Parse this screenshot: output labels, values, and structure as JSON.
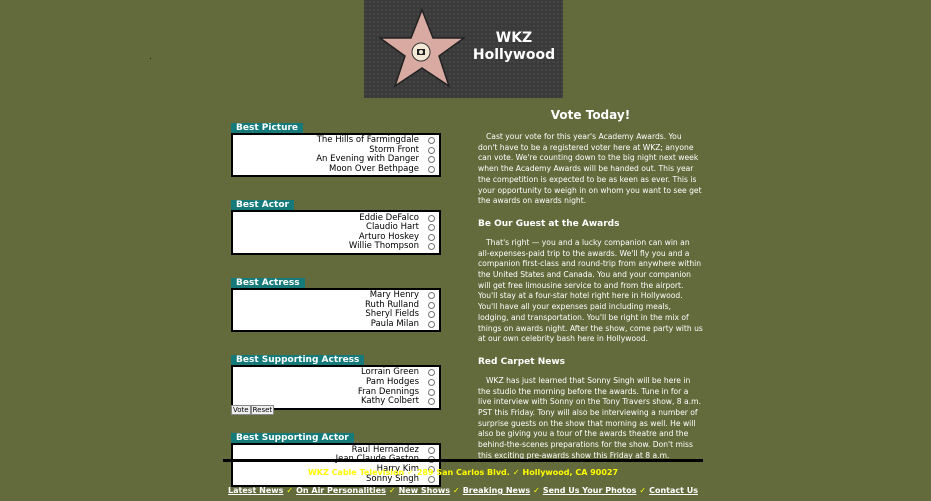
{
  "logo": {
    "line1": "WKZ",
    "line2": "Hollywood",
    "icon": "hollywood-star-icon"
  },
  "ballot": {
    "categories": [
      {
        "title": "Best Picture",
        "nominees": [
          "The Hills of Farmingdale",
          "Storm Front",
          "An Evening with Danger",
          "Moon Over Bethpage"
        ]
      },
      {
        "title": "Best Actor",
        "nominees": [
          "Eddie DeFalco",
          "Claudio Hart",
          "Arturo Hoskey",
          "Willie Thompson"
        ]
      },
      {
        "title": "Best Actress",
        "nominees": [
          "Mary Henry",
          "Ruth Rulland",
          "Sheryl Fields",
          "Paula Milan"
        ]
      },
      {
        "title": "Best Supporting Actress",
        "nominees": [
          "Lorrain Green",
          "Pam Hodges",
          "Fran Dennings",
          "Kathy Colbert"
        ]
      },
      {
        "title": "Best Supporting Actor",
        "nominees": [
          "Raul Hernandez",
          "Jean Claude Gaston",
          "Harry Kim",
          "Sonny Singh"
        ]
      }
    ],
    "vote_label": "Vote",
    "reset_label": "Reset"
  },
  "article": {
    "title": "Vote Today!",
    "intro": "Cast your vote for this year's Academy Awards. You don't have to be a registered voter here at WKZ; anyone can vote. We're counting down to the big night next week when the Academy Awards will be handed out. This year the competition is expected to be as keen as ever. This is your opportunity to weigh in on whom you want to see get the awards on awards night.",
    "section1_heading": "Be Our Guest at the Awards",
    "section1_body": "That's right — you and a lucky companion can win an all-expenses-paid trip to the awards. We'll fly you and a companion first-class and round-trip from anywhere within the United States and Canada. You and your companion will get free limousine service to and from the airport. You'll stay at a four-star hotel right here in Hollywood. You'll have all your expenses paid including meals, lodging, and transportation. You'll be right in the mix of things on awards night. After the show, come party with us at our own celebrity bash here in Hollywood.",
    "section2_heading": "Red Carpet News",
    "section2_body": "WKZ has just learned that Sonny Singh will be here in the studio the morning before the awards. Tune in for a live interview with Sonny on the Tony Travers show, 8 a.m. PST this Friday. Tony will also be interviewing a number of surprise guests on the show that morning as well. He will also be giving you a tour of the awards theatre and the behind-the-scenes preparations for the show. Don't miss this exciting pre-awards show this Friday at 8 a.m."
  },
  "footer": {
    "address_parts": [
      "WKZ Cable Television",
      "289 San Carlos Blvd.",
      "Hollywood, CA 90027"
    ],
    "nav": [
      "Latest News",
      "On Air Personalities",
      "New Shows",
      "Breaking News",
      "Send Us Your Photos",
      "Contact Us"
    ],
    "separator": "✓"
  },
  "colors": {
    "background": "#636b3c",
    "tab": "#177a7a",
    "accent": "#ffff00"
  }
}
